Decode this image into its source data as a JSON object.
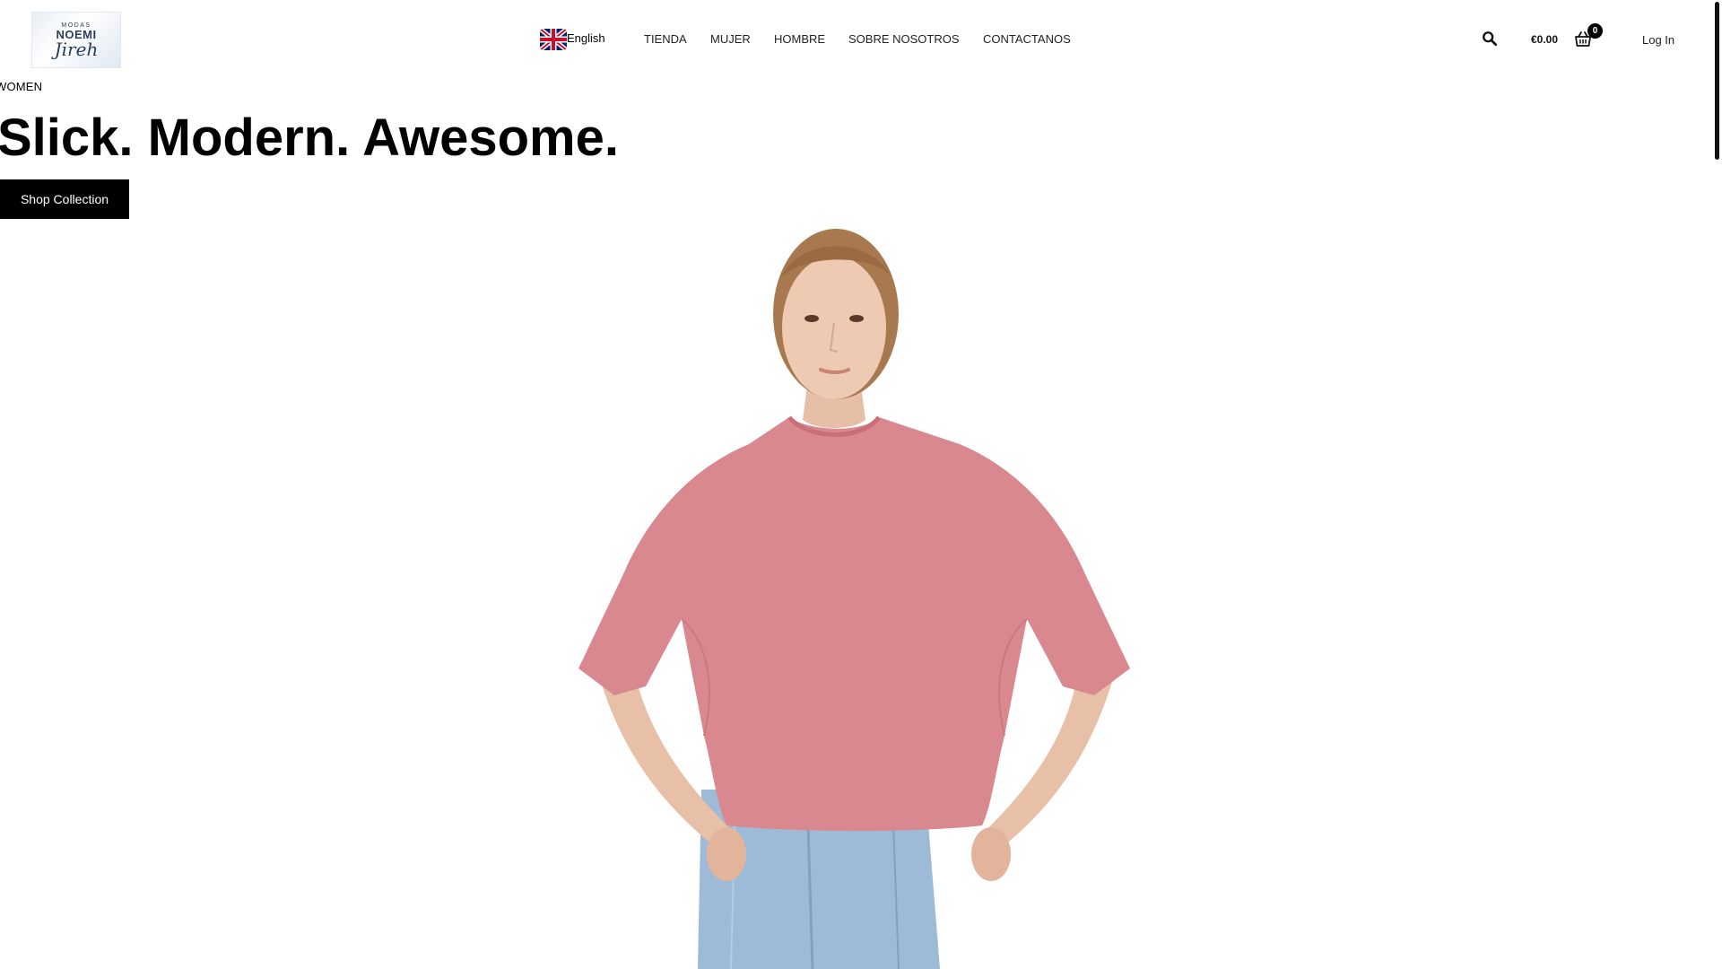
{
  "header": {
    "logo": {
      "line1": "MODAS",
      "line2": "NOEMI",
      "line3": "Jireh"
    },
    "language": {
      "label": "English",
      "flag_icon": "uk-flag-icon"
    },
    "nav": [
      {
        "label": "TIENDA"
      },
      {
        "label": "MUJER"
      },
      {
        "label": "HOMBRE"
      },
      {
        "label": "SOBRE NOSOTROS"
      },
      {
        "label": "CONTACTANOS"
      }
    ],
    "search_icon": "search-icon",
    "cart": {
      "total": "€0.00",
      "count": "0",
      "icon": "basket-icon"
    },
    "login": "Log In"
  },
  "hero": {
    "eyebrow": "WOMEN",
    "title": "Slick. Modern. Awesome.",
    "cta": "Shop Collection",
    "image": "model-pink-tshirt-jeans-photo"
  },
  "colors": {
    "text": "#000000",
    "button_bg": "#000000",
    "button_text": "#ffffff",
    "tshirt": "#d9838c",
    "jeans": "#8fb3d1",
    "logo_text": "#2a3e5c"
  }
}
